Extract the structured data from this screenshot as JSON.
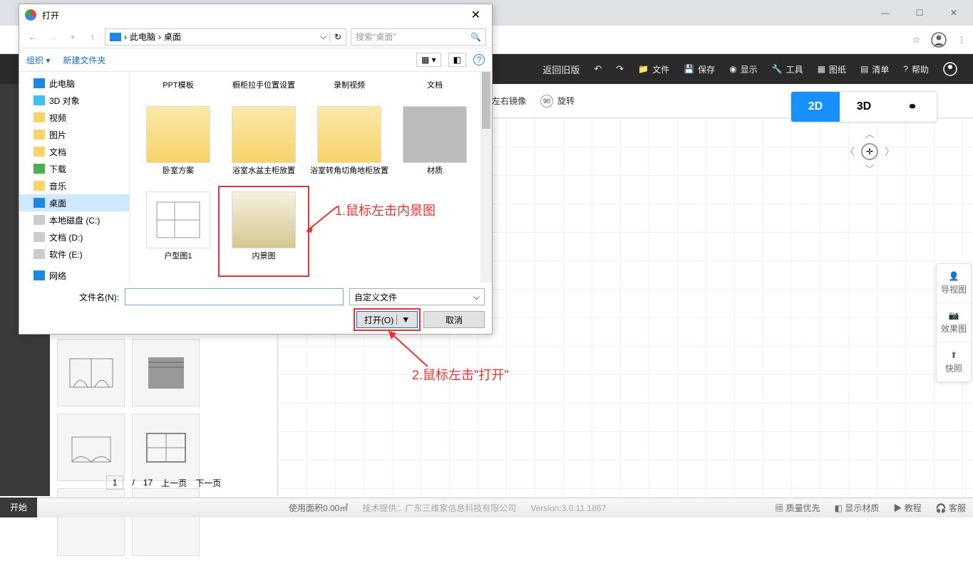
{
  "browser": {
    "win_minimize": "—",
    "win_maximize": "☐",
    "win_close": "✕"
  },
  "app_toolbar": {
    "back_old": "返回旧版",
    "file": "文件",
    "save": "保存",
    "display": "显示",
    "tools": "工具",
    "drawing": "图纸",
    "list": "清单",
    "help": "帮助"
  },
  "sec_toolbar": {
    "mirror": "左右镜像",
    "rotate": "旋转"
  },
  "view_modes": {
    "v2d": "2D",
    "v3d": "3D",
    "vwalk": "⚭"
  },
  "right_panel": {
    "nav_view": "导视图",
    "effect": "效果图",
    "snapshot": "快照"
  },
  "dialog": {
    "title": "打开",
    "path_pc": "此电脑",
    "path_desktop": "桌面",
    "search_placeholder": "搜索\"桌面\"",
    "organize": "组织",
    "new_folder": "新建文件夹",
    "tree": {
      "this_pc": "此电脑",
      "objects_3d": "3D 对象",
      "videos": "视频",
      "pictures": "图片",
      "documents": "文档",
      "downloads": "下载",
      "music": "音乐",
      "desktop": "桌面",
      "local_c": "本地磁盘 (C:)",
      "doc_d": "文档 (D:)",
      "soft_e": "软件 (E:)",
      "network": "网络"
    },
    "files": {
      "row1": [
        "PPT模板",
        "橱柜拉手位置设置",
        "录制视频",
        "文档"
      ],
      "row2": [
        "卧室方案",
        "浴室水盆主柜放置",
        "浴室转角切角地柜放置",
        "材质"
      ],
      "row3": [
        "户型图1",
        "内景图"
      ]
    },
    "filename_label": "文件名(N):",
    "filter_label": "自定义文件",
    "open_btn": "打开(O)",
    "cancel_btn": "取消"
  },
  "annotations": {
    "a1": "1.鼠标左击内景图",
    "a2": "2.鼠标左击\"打开\""
  },
  "status": {
    "start": "开始",
    "area": "使用面积0.00㎡",
    "tech": "技术提供：广东三维家信息科技有限公司",
    "version": "Version:3.0.11.1867",
    "quality": "质量优先",
    "material": "显示材质",
    "tutorial": "教程",
    "service": "客服"
  },
  "pager": {
    "page": "1",
    "total": "17",
    "sep": "/",
    "prev": "上一页",
    "next": "下一页"
  }
}
